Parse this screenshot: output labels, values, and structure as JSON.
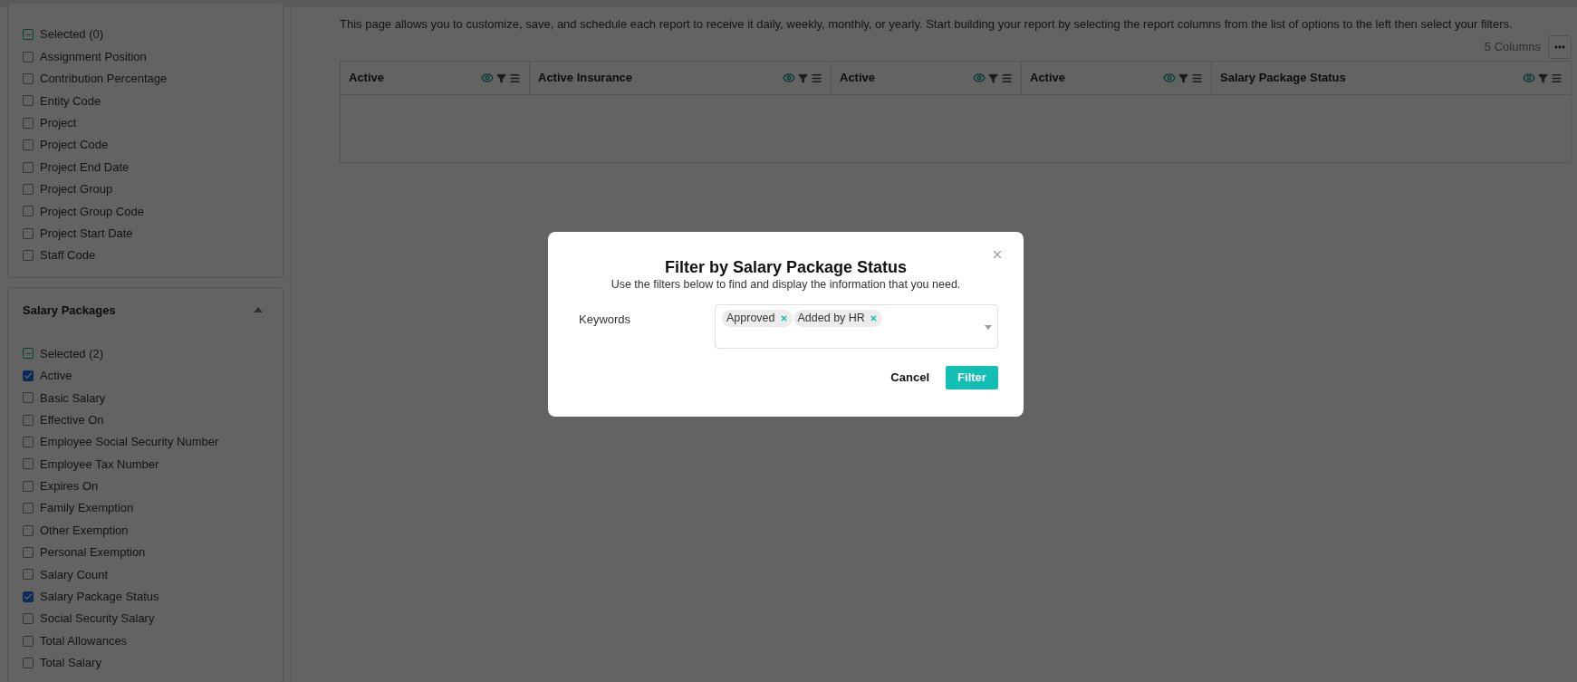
{
  "sidebar": {
    "sections": [
      {
        "selected_label": "Selected (0)",
        "items": [
          {
            "label": "Assignment Position",
            "checked": false
          },
          {
            "label": "Contribution Percentage",
            "checked": false
          },
          {
            "label": "Entity Code",
            "checked": false
          },
          {
            "label": "Project",
            "checked": false
          },
          {
            "label": "Project Code",
            "checked": false
          },
          {
            "label": "Project End Date",
            "checked": false
          },
          {
            "label": "Project Group",
            "checked": false
          },
          {
            "label": "Project Group Code",
            "checked": false
          },
          {
            "label": "Project Start Date",
            "checked": false
          },
          {
            "label": "Staff Code",
            "checked": false
          }
        ]
      },
      {
        "title": "Salary Packages",
        "expanded": true,
        "selected_label": "Selected (2)",
        "items": [
          {
            "label": "Active",
            "checked": true
          },
          {
            "label": "Basic Salary",
            "checked": false
          },
          {
            "label": "Effective On",
            "checked": false
          },
          {
            "label": "Employee Social Security Number",
            "checked": false
          },
          {
            "label": "Employee Tax Number",
            "checked": false
          },
          {
            "label": "Expires On",
            "checked": false
          },
          {
            "label": "Family Exemption",
            "checked": false
          },
          {
            "label": "Other Exemption",
            "checked": false
          },
          {
            "label": "Personal Exemption",
            "checked": false
          },
          {
            "label": "Salary Count",
            "checked": false
          },
          {
            "label": "Salary Package Status",
            "checked": true
          },
          {
            "label": "Social Security Salary",
            "checked": false
          },
          {
            "label": "Total Allowances",
            "checked": false
          },
          {
            "label": "Total Salary",
            "checked": false
          }
        ]
      }
    ]
  },
  "description": "This page allows you to customize, save, and schedule each report to receive it daily, weekly, monthly, or yearly. Start building your report by selecting the report columns from the list of options to the left then select your filters.",
  "column_count": "5 Columns",
  "table": {
    "columns": [
      {
        "label": "Active"
      },
      {
        "label": "Active Insurance"
      },
      {
        "label": "Active"
      },
      {
        "label": "Active"
      },
      {
        "label": "Salary Package Status"
      }
    ]
  },
  "dialog": {
    "title": "Filter by Salary Package Status",
    "subtitle": "Use the filters below to find and display the information that you need.",
    "field_label": "Keywords",
    "tags": [
      {
        "label": "Approved"
      },
      {
        "label": "Added by HR"
      }
    ],
    "buttons": {
      "cancel": "Cancel",
      "submit": "Filter"
    }
  }
}
